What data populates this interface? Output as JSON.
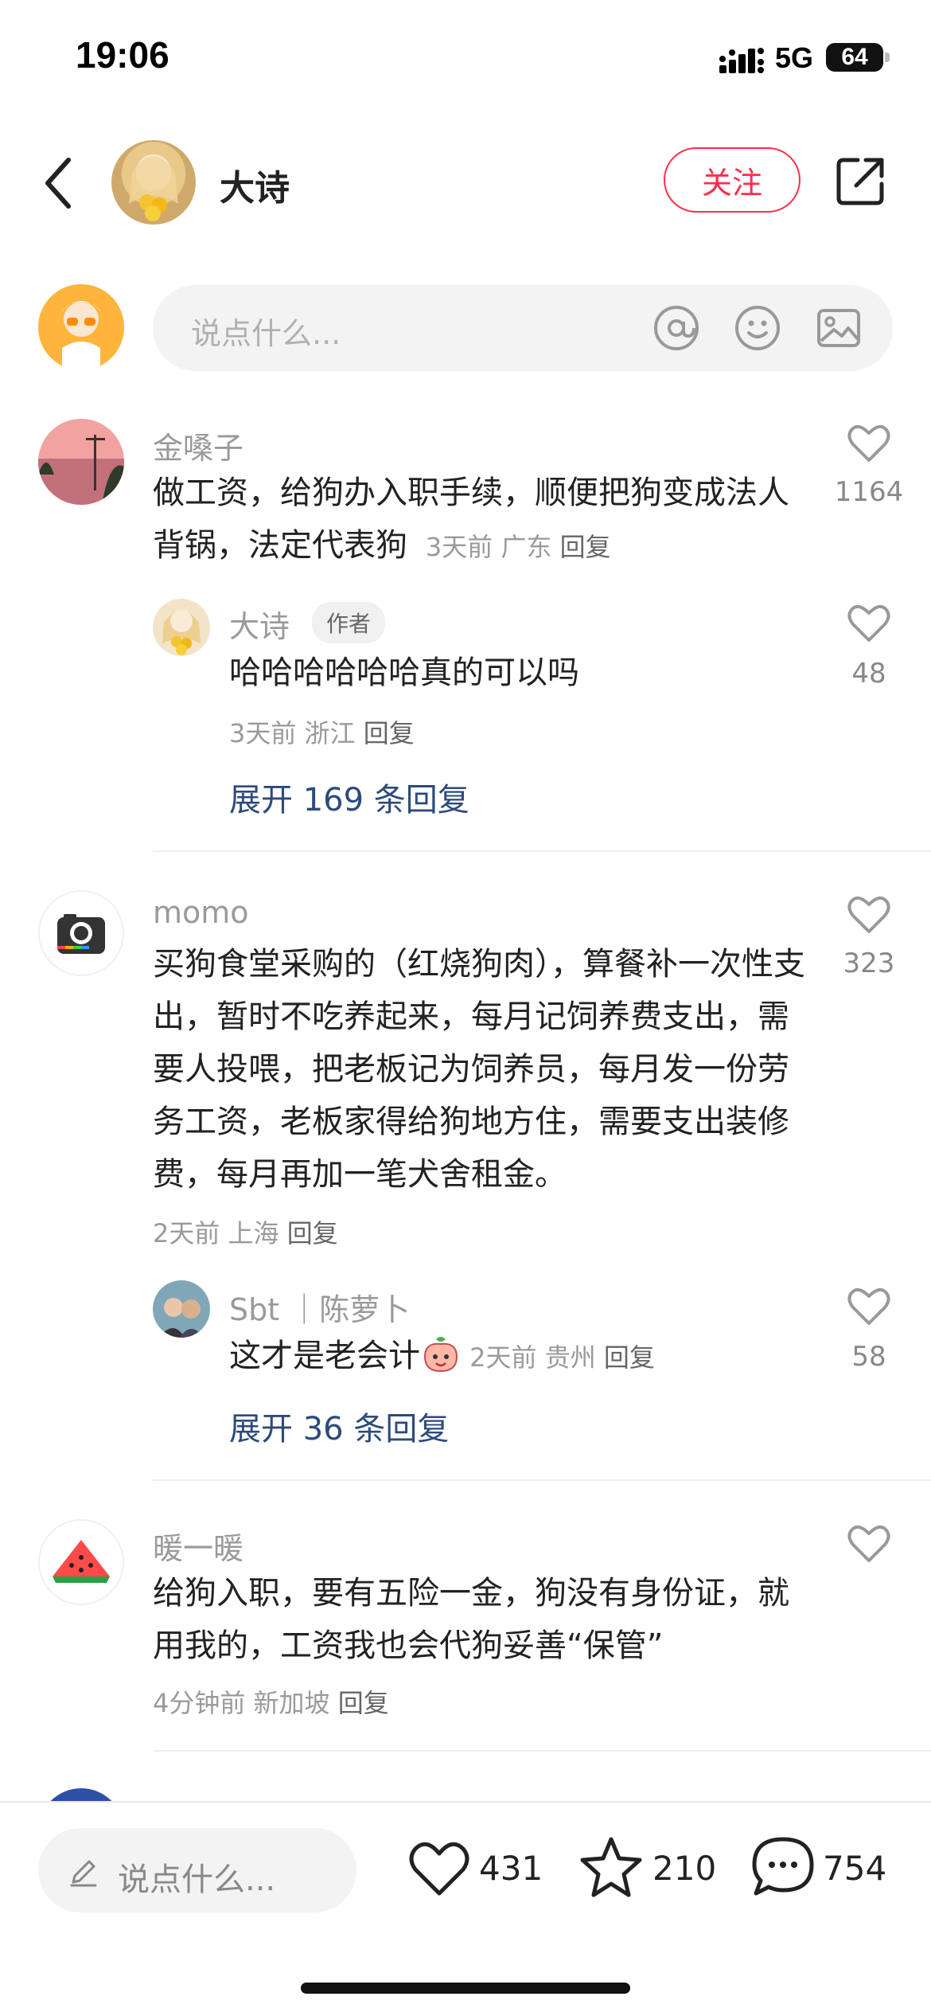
{
  "status_bar": {
    "time": "19:06",
    "network": "5G",
    "battery": "64"
  },
  "header": {
    "author_name": "大诗",
    "follow_label": "关注"
  },
  "comment_input": {
    "placeholder": "说点什么..."
  },
  "comments": [
    {
      "username": "金嗓子",
      "text": "做工资，给狗办入职手续，顺便把狗变成法人背锅，法定代表狗",
      "time": "3天前",
      "location": "广东",
      "reply_label": "回复",
      "likes": "1164",
      "reply": {
        "username": "大诗",
        "badge": "作者",
        "text": "哈哈哈哈哈哈真的可以吗",
        "time": "3天前",
        "location": "浙江",
        "reply_label": "回复",
        "likes": "48"
      },
      "expand_label": "展开 169 条回复"
    },
    {
      "username": "momo",
      "text": "买狗食堂采购的（红烧狗肉），算餐补一次性支出，暂时不吃养起来，每月记饲养费支出，需要人投喂，把老板记为饲养员，每月发一份劳务工资，老板家得给狗地方住，需要支出装修费，每月再加一笔犬舍租金。",
      "time": "2天前",
      "location": "上海",
      "reply_label": "回复",
      "likes": "323",
      "reply": {
        "username": "Sbt ｜陈萝卜",
        "text": "这才是老会计",
        "time": "2天前",
        "location": "贵州",
        "reply_label": "回复",
        "likes": "58"
      },
      "expand_label": "展开 36 条回复"
    },
    {
      "username": "暖一暖",
      "text": "给狗入职，要有五险一金，狗没有身份证，就用我的，工资我也会代狗妥善“保管”",
      "time": "4分钟前",
      "location": "新加坡",
      "reply_label": "回复"
    }
  ],
  "bottom_bar": {
    "placeholder": "说点什么...",
    "likes": "431",
    "stars": "210",
    "comments": "754"
  },
  "colors": {
    "accent": "#ff2e4d",
    "link": "#2d4a7e"
  }
}
